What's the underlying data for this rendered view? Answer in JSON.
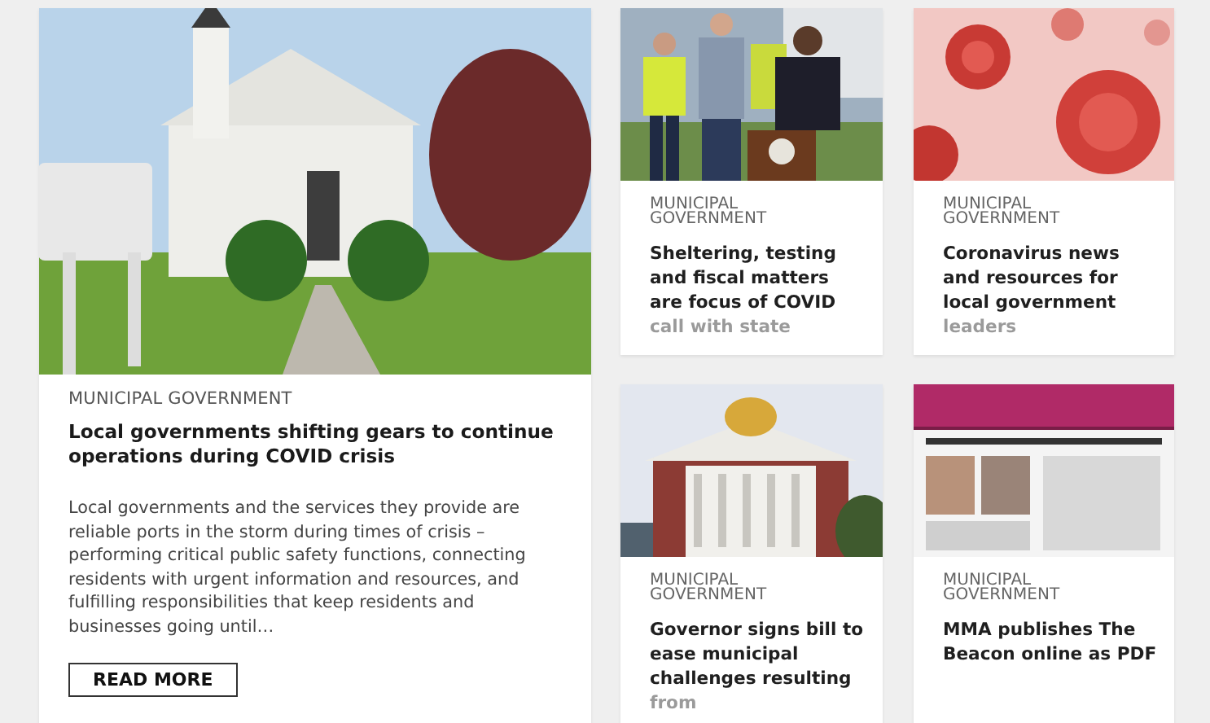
{
  "featured": {
    "category": "MUNICIPAL GOVERNMENT",
    "title": "Local governments shifting gears to continue operations during COVID crisis",
    "excerpt": "Local governments and the services they provide are reliable ports in the storm during times of crisis – performing critical public safety functions, connecting residents with urgent information and resources, and fulfilling responsibilities that keep residents and businesses going until…",
    "button": "READ MORE"
  },
  "articles": [
    {
      "category": "MUNICIPAL GOVERNMENT",
      "title": "Sheltering, testing and fiscal matters are focus of COVID call with state"
    },
    {
      "category": "MUNICIPAL GOVERNMENT",
      "title": "Coronavirus news and resources for local government leaders"
    },
    {
      "category": "MUNICIPAL GOVERNMENT",
      "title": "Governor signs bill to ease municipal challenges resulting from"
    },
    {
      "category": "MUNICIPAL GOVERNMENT",
      "title": "MMA publishes The Beacon online as PDF"
    }
  ]
}
